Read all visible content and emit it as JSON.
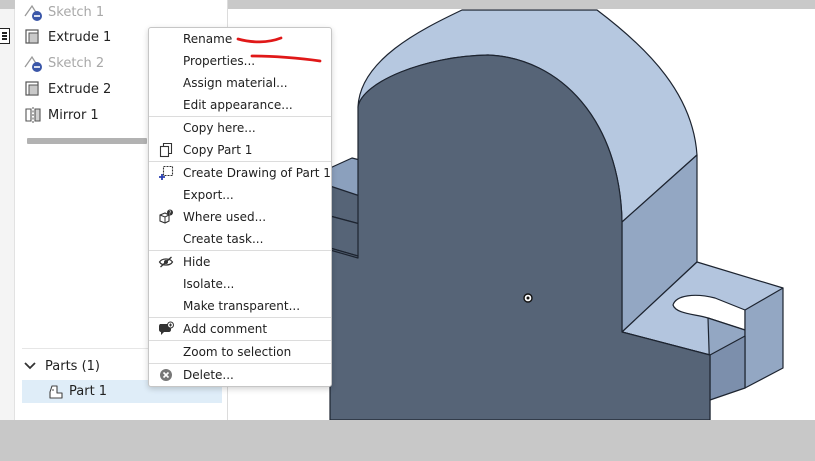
{
  "sidebar": {
    "features": [
      {
        "label": "Sketch 1",
        "icon": "sketch-suppressed-icon",
        "suppressed": true
      },
      {
        "label": "Extrude 1",
        "icon": "extrude-icon",
        "suppressed": false
      },
      {
        "label": "Sketch 2",
        "icon": "sketch-suppressed-icon",
        "suppressed": true
      },
      {
        "label": "Extrude 2",
        "icon": "extrude-icon",
        "suppressed": false
      },
      {
        "label": "Mirror 1",
        "icon": "mirror-icon",
        "suppressed": false
      }
    ],
    "parts_header": "Parts (1)",
    "part_item": "Part 1"
  },
  "context_menu": {
    "items": [
      {
        "label": "Rename",
        "icon": null
      },
      {
        "label": "Properties...",
        "icon": null
      },
      {
        "label": "Assign material...",
        "icon": null
      },
      {
        "label": "Edit appearance...",
        "icon": null
      },
      {
        "label": "Copy here...",
        "icon": null
      },
      {
        "label": "Copy Part 1",
        "icon": "copy-icon"
      },
      {
        "label": "Create Drawing of Part 1...",
        "icon": "create-drawing-icon"
      },
      {
        "label": "Export...",
        "icon": null
      },
      {
        "label": "Where used...",
        "icon": "where-used-icon"
      },
      {
        "label": "Create task...",
        "icon": null
      },
      {
        "label": "Hide",
        "icon": "hide-eye-icon"
      },
      {
        "label": "Isolate...",
        "icon": null
      },
      {
        "label": "Make transparent...",
        "icon": null
      },
      {
        "label": "Add comment",
        "icon": "add-comment-icon"
      },
      {
        "label": "Zoom to selection",
        "icon": null
      },
      {
        "label": "Delete...",
        "icon": "delete-icon"
      }
    ]
  },
  "colors": {
    "annotation_red": "#e01818",
    "selected_row": "#dfedf8",
    "part_face_dark": "#566477",
    "part_face_light": "#93a7c3",
    "part_face_top": "#b6c8e0"
  }
}
